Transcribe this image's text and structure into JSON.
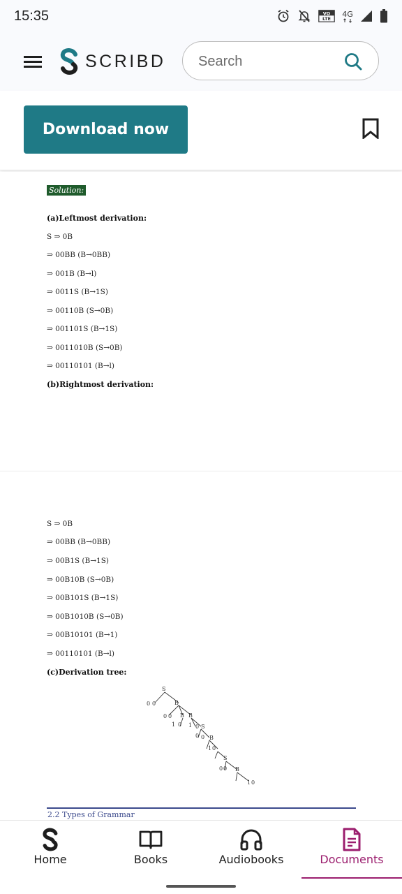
{
  "status_bar": {
    "time": "15:35",
    "icons": [
      "alarm-icon",
      "notifications-off-icon",
      "volte-icon",
      "4g-icon",
      "signal-icon",
      "battery-icon"
    ],
    "volte_label": "VO LTE",
    "network": "4G"
  },
  "header": {
    "brand": "SCRIBD",
    "search_placeholder": "Search"
  },
  "actions": {
    "download_label": "Download now"
  },
  "document": {
    "solution_label": "Solution:",
    "leftmost_heading": "(a)Leftmost derivation:",
    "leftmost_steps": [
      "S ⇒ 0B",
      "⇒ 00BB (B→0BB)",
      "⇒ 001B (B→l)",
      "⇒ 0011S (B→1S)",
      "⇒ 00110B (S→0B)",
      "⇒ 001101S (B→1S)",
      "⇒ 0011010B (S→0B)",
      "⇒ 00110101 (B→l)"
    ],
    "rightmost_heading": "(b)Rightmost derivation:",
    "rightmost_steps": [
      "S ⇒ 0B",
      "⇒ 00BB (B→0BB)",
      "⇒ 00B1S (B→1S)",
      "⇒ 00B10B (S→0B)",
      "⇒ 00B101S (B→1S)",
      "⇒ 00B1010B (S→0B)",
      "⇒ 00B10101 (B→1)",
      "⇒ 00110101 (B→l)"
    ],
    "tree_heading": "(c)Derivation tree:",
    "footer_text": "2.2 Types of Grammar"
  },
  "bottom_nav": {
    "items": [
      {
        "label": "Home",
        "icon": "scribd-home-icon"
      },
      {
        "label": "Books",
        "icon": "book-icon"
      },
      {
        "label": "Audiobooks",
        "icon": "headphones-icon"
      },
      {
        "label": "Documents",
        "icon": "document-icon"
      }
    ],
    "active": "Documents",
    "active_color": "#9b1e6e"
  },
  "colors": {
    "brand_teal": "#1f7a86",
    "solution_bg": "#1f5b2c",
    "accent_magenta": "#9b1e6e"
  }
}
